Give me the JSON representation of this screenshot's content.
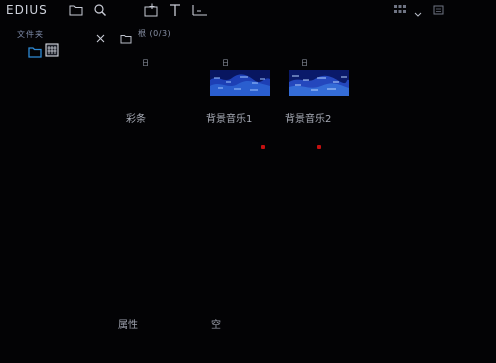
{
  "app": {
    "title": "EDIUS"
  },
  "folder_pane": {
    "title": "文件夹",
    "close_glyph": "×"
  },
  "bin": {
    "header": "根 (0/3)"
  },
  "clips": [
    {
      "mark": "日",
      "label": "彩条",
      "has_thumbnail": false
    },
    {
      "mark": "日",
      "label": "背景音乐1",
      "has_thumbnail": true
    },
    {
      "mark": "日",
      "label": "背景音乐2",
      "has_thumbnail": true
    }
  ],
  "bottom_labels": [
    "属性",
    "空"
  ],
  "icons": {
    "open-folder": "folder-open-icon",
    "search": "search-icon",
    "add-clip": "add-clip-icon",
    "title": "text-icon",
    "timeline": "timeline-icon",
    "view": "grid-view-icon",
    "dropdown": "chevron-down-icon",
    "settings": "settings-icon"
  },
  "colors": {
    "background": "#030305",
    "accent": "#2e8ad6",
    "flag": "#c41010",
    "thumbnail": "#0a1a66"
  }
}
